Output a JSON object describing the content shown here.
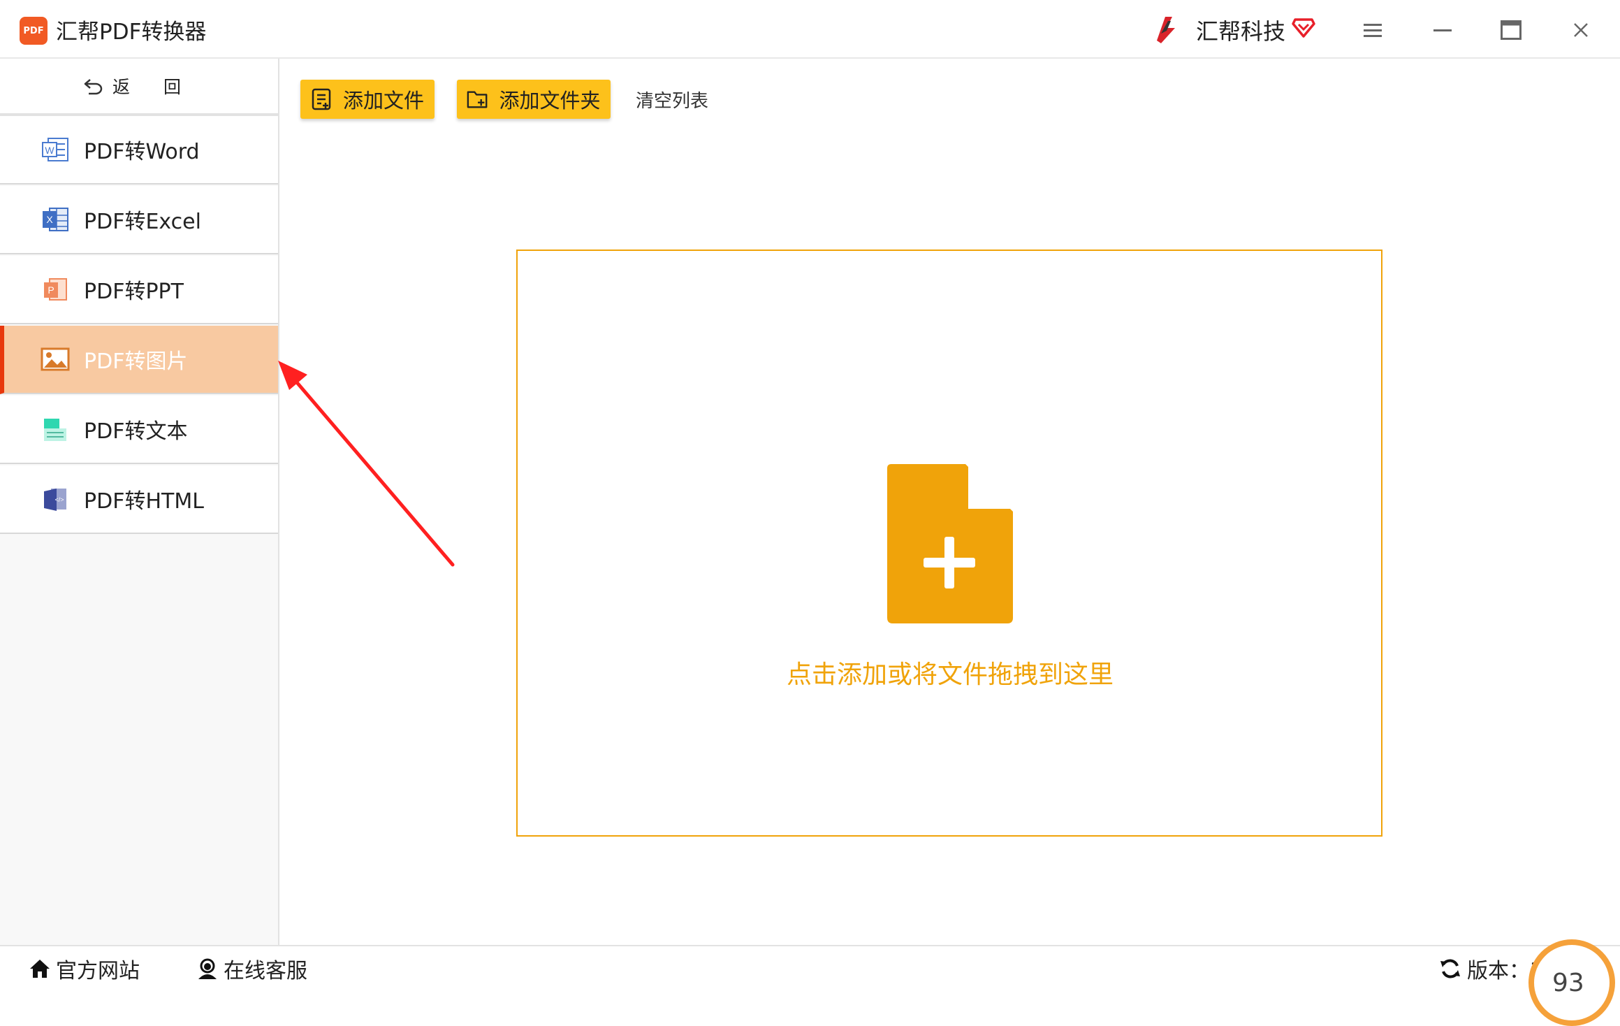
{
  "window": {
    "title": "汇帮PDF转换器",
    "logo_text": "PDF",
    "brand_name": "汇帮科技"
  },
  "colors": {
    "accent": "#fdc11b",
    "drop_orange": "#f0a30a",
    "active_bg": "#f8c9a1",
    "active_border": "#e8380d",
    "arrow": "#ff2020"
  },
  "sidebar": {
    "back_label": "返 回",
    "items": [
      {
        "label": "PDF转Word",
        "icon": "word-icon",
        "active": false
      },
      {
        "label": "PDF转Excel",
        "icon": "excel-icon",
        "active": false
      },
      {
        "label": "PDF转PPT",
        "icon": "ppt-icon",
        "active": false
      },
      {
        "label": "PDF转图片",
        "icon": "image-icon",
        "active": true
      },
      {
        "label": "PDF转文本",
        "icon": "text-icon",
        "active": false
      },
      {
        "label": "PDF转HTML",
        "icon": "html-icon",
        "active": false
      }
    ]
  },
  "toolbar": {
    "add_file": "添加文件",
    "add_folder": "添加文件夹",
    "clear_list": "清空列表"
  },
  "dropzone": {
    "hint": "点击添加或将文件拖拽到这里",
    "icon": "file-add-icon"
  },
  "footer": {
    "site": "官方网站",
    "service": "在线客服",
    "version": "版本：3",
    "speed": "93"
  }
}
